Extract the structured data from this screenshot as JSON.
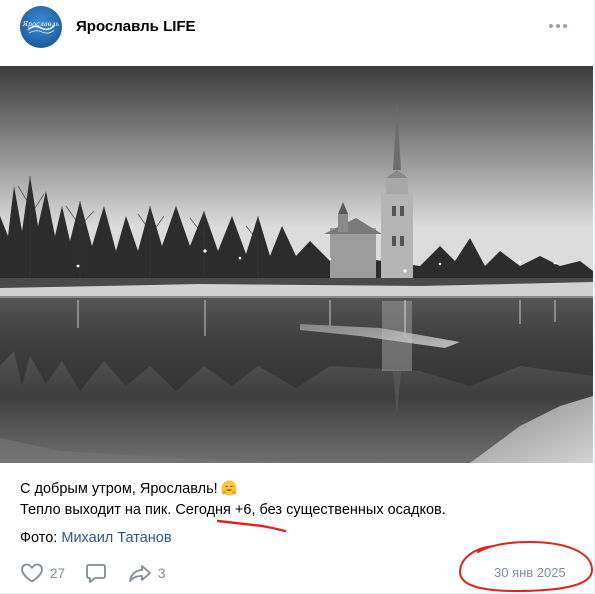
{
  "community": {
    "name": "Ярославль LIFE",
    "avatar_logo_text": "Ярославль"
  },
  "header": {
    "more_icon": "more-horizontal-icon"
  },
  "post": {
    "line1": "С добрым утром, Ярославль!",
    "line1_emoji": "smiling-face-with-open-hands-emoji",
    "line2": "Тепло выходит на пик. Сегодня +6, без существенных осадков.",
    "credit_label": "Фото:",
    "credit_author": "Михаил Татанов"
  },
  "footer": {
    "likes": "27",
    "reposts": "3",
    "like_icon": "heart-icon",
    "comment_icon": "comment-icon",
    "share_icon": "share-arrow-icon",
    "date": "30 янв 2025"
  },
  "colors": {
    "link": "#2a5885",
    "muted": "#818c99",
    "annotation": "#e0241b"
  }
}
